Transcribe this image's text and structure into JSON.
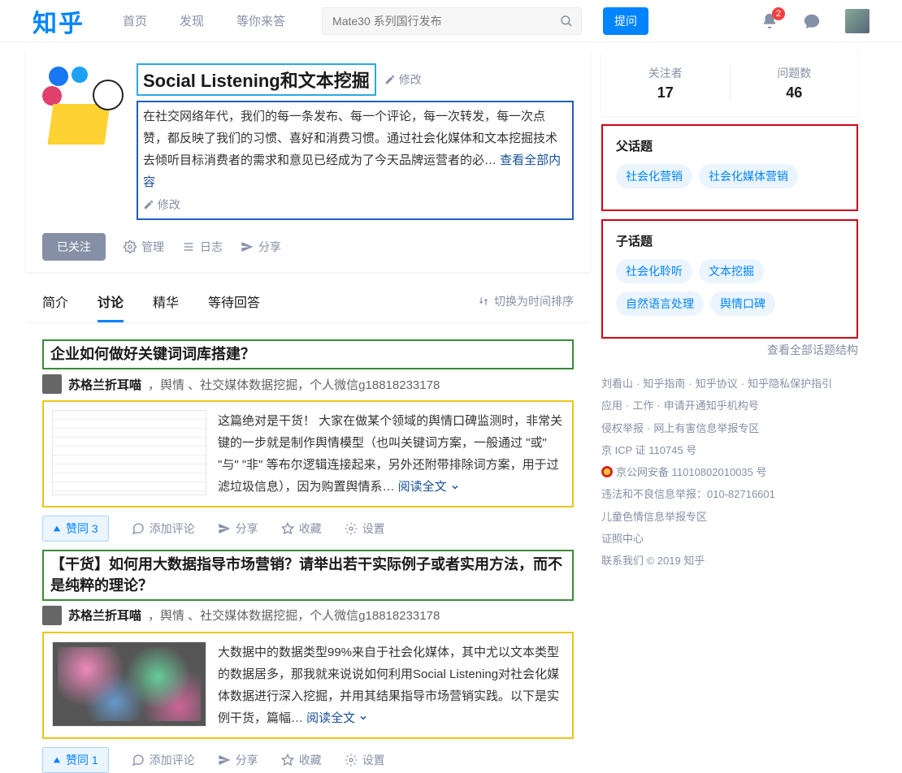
{
  "header": {
    "logo": "知乎",
    "nav": {
      "home": "首页",
      "discover": "发现",
      "answer": "等你来答"
    },
    "search_placeholder": "Mate30 系列国行发布",
    "ask": "提问",
    "notif_count": "2"
  },
  "topic": {
    "title": "Social Listening和文本挖掘",
    "edit": "修改",
    "desc": "在社交网络年代，我们的每一条发布、每一个评论，每一次转发，每一次点赞，都反映了我们的习惯、喜好和消费习惯。通过社会化媒体和文本挖掘技术去倾听目标消费者的需求和意见已经成为了今天品牌运营者的必… ",
    "desc_more": "查看全部内容",
    "followed": "已关注",
    "manage": "管理",
    "log": "日志",
    "share": "分享"
  },
  "tabs": {
    "intro": "简介",
    "discuss": "讨论",
    "essence": "精华",
    "pending": "等待回答",
    "sort": "切换为时间排序"
  },
  "posts": [
    {
      "title": "企业如何做好关键词词库搭建？",
      "author": "苏格兰折耳喵",
      "author_tag": "，舆情 、社交媒体数据挖掘，个人微信g18818233178",
      "excerpt": "这篇绝对是干货！  大家在做某个领域的舆情口碑监测时，非常关键的一步就是制作舆情模型（也叫关键词方案，一般通过 \"或\" \"与\" \"非\" 等布尔逻辑连接起来，另外还附带排除词方案，用于过滤垃圾信息），因为购置舆情系… ",
      "vote": "赞同 3",
      "thumb": "t1"
    },
    {
      "title": "【干货】如何用大数据指导市场营销？请举出若干实际例子或者实用方法，而不是纯粹的理论？",
      "author": "苏格兰折耳喵",
      "author_tag": "，舆情 、社交媒体数据挖掘，个人微信g18818233178",
      "excerpt": "大数据中的数据类型99%来自于社会化媒体，其中尤以文本类型的数据居多，那我就来说说如何利用Social Listening对社会化媒体数据进行深入挖掘，并用其结果指导市场营销实践。以下是实例干货，篇幅… ",
      "vote": "赞同 1",
      "thumb": "t2"
    }
  ],
  "post_actions": {
    "read_more": "阅读全文",
    "comment": "添加评论",
    "share": "分享",
    "fav": "收藏",
    "settings": "设置"
  },
  "stats": {
    "follower_label": "关注者",
    "follower": "17",
    "question_label": "问题数",
    "question": "46"
  },
  "parent_topic": {
    "title": "父话题",
    "tags": [
      "社会化营销",
      "社会化媒体营销"
    ]
  },
  "child_topic": {
    "title": "子话题",
    "tags": [
      "社会化聆听",
      "文本挖掘",
      "自然语言处理",
      "舆情口碑"
    ]
  },
  "view_all_topics": "查看全部话题结构",
  "footer": {
    "l1": [
      "刘看山",
      "知乎指南",
      "知乎协议",
      "知乎隐私保护指引"
    ],
    "l2": [
      "应用",
      "工作",
      "申请开通知乎机构号"
    ],
    "l3": [
      "侵权举报",
      "网上有害信息举报专区"
    ],
    "icp": "京 ICP 证 110745 号",
    "police": "京公网安备 11010802010035 号",
    "report": "违法和不良信息举报：010-82716601",
    "child": "儿童色情信息举报专区",
    "cert": "证照中心",
    "contact": "联系我们 © 2019 知乎"
  }
}
